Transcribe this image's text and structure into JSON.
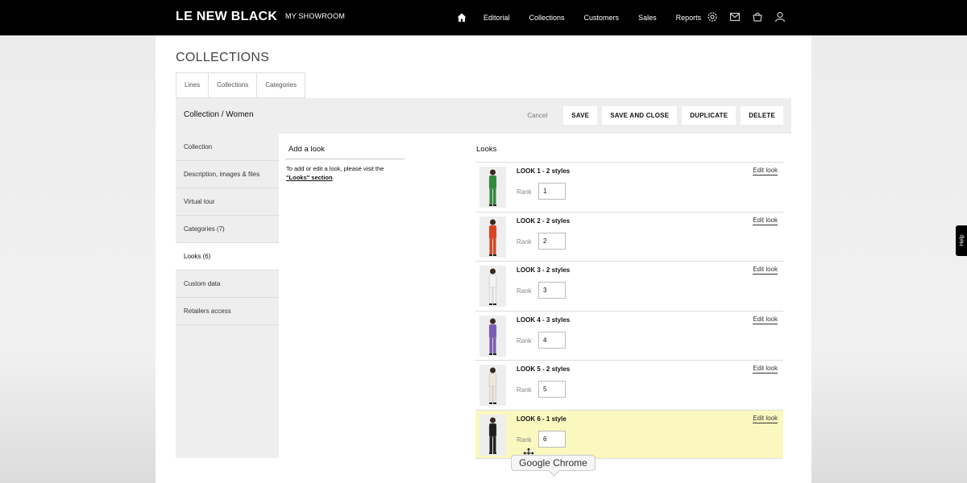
{
  "header": {
    "logo": "LE NEW BLACK",
    "showroom": "MY SHOWROOM",
    "nav": [
      "Editorial",
      "Collections",
      "Customers",
      "Sales",
      "Reports"
    ]
  },
  "page": {
    "title": "COLLECTIONS",
    "tabs": [
      "Lines",
      "Collections",
      "Categories"
    ],
    "breadcrumb": "Collection / Women",
    "cancel": "Cancel",
    "buttons": {
      "save": "SAVE",
      "save_close": "SAVE AND CLOSE",
      "duplicate": "DUPLICATE",
      "delete": "DELETE"
    }
  },
  "menu": [
    {
      "label": "Collection",
      "active": false
    },
    {
      "label": "Description, images & files",
      "active": false
    },
    {
      "label": "Virtual tour",
      "active": false
    },
    {
      "label": "Categories (7)",
      "active": false
    },
    {
      "label": "Looks (6)",
      "active": true
    },
    {
      "label": "Custom data",
      "active": false
    },
    {
      "label": "Retailers access",
      "active": false
    }
  ],
  "add_look": {
    "heading": "Add a look",
    "text": "To add or edit a look, please visit the",
    "link": "\"Looks\" section",
    "after": "."
  },
  "looks": {
    "heading": "Looks",
    "rank_label": "Rank",
    "edit_label": "Edit look",
    "items": [
      {
        "title": "LOOK 1 - 2 styles",
        "rank": "1",
        "outfit_color": "#2f8a3b"
      },
      {
        "title": "LOOK 2 - 2 styles",
        "rank": "2",
        "outfit_color": "#d9431e"
      },
      {
        "title": "LOOK 3 - 2 styles",
        "rank": "3",
        "outfit_color": "#f2f2f2"
      },
      {
        "title": "LOOK 4 - 3 styles",
        "rank": "4",
        "outfit_color": "#7b5bb6"
      },
      {
        "title": "LOOK 5 - 2 styles",
        "rank": "5",
        "outfit_color": "#ece7dc"
      },
      {
        "title": "LOOK 6 - 1 style",
        "rank": "6",
        "outfit_color": "#1e1e1e",
        "highlight": true
      }
    ]
  },
  "tooltip": "Google Chrome",
  "help": "Help"
}
